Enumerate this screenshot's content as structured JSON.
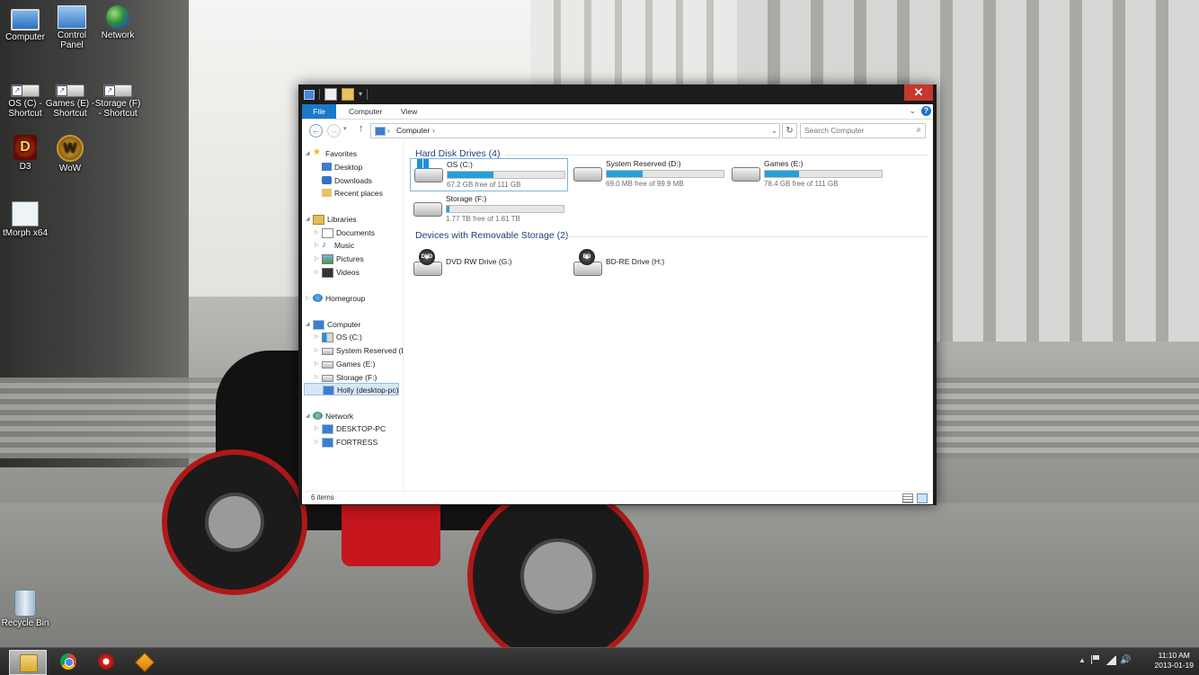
{
  "desktop": {
    "icons": [
      {
        "label": "Computer",
        "icon": "computer-icon"
      },
      {
        "label": "Control Panel",
        "icon": "control-panel-icon"
      },
      {
        "label": "Network",
        "icon": "network-icon"
      },
      {
        "label": "OS (C) - Shortcut",
        "icon": "drive-shortcut-icon"
      },
      {
        "label": "Games (E) - Shortcut",
        "icon": "drive-shortcut-icon"
      },
      {
        "label": "Storage (F) - Shortcut",
        "icon": "drive-shortcut-icon"
      },
      {
        "label": "D3",
        "icon": "diablo3-icon",
        "glyph": "D"
      },
      {
        "label": "WoW",
        "icon": "wow-icon",
        "glyph": "W"
      },
      {
        "label": "tMorph x64",
        "icon": "tmorph-icon"
      },
      {
        "label": "Recycle Bin",
        "icon": "recycle-bin-icon"
      }
    ]
  },
  "window": {
    "close_glyph": "✕",
    "ribbon": {
      "tabs": [
        "File",
        "Computer",
        "View"
      ],
      "help_glyph": "?",
      "minimize_ribbon_glyph": "⌄"
    },
    "address": {
      "path": [
        "Computer"
      ],
      "sep_glyph": "›",
      "search_placeholder": "Search Computer"
    },
    "nav_pane": {
      "favorites": {
        "label": "Favorites",
        "items": [
          "Desktop",
          "Downloads",
          "Recent places"
        ]
      },
      "libraries": {
        "label": "Libraries",
        "items": [
          "Documents",
          "Music",
          "Pictures",
          "Videos"
        ]
      },
      "homegroup": {
        "label": "Homegroup"
      },
      "computer": {
        "label": "Computer",
        "items": [
          "OS (C:)",
          "System Reserved (D:)",
          "Games (E:)",
          "Storage (F:)",
          "Holly (desktop-pc)"
        ]
      },
      "network": {
        "label": "Network",
        "items": [
          "DESKTOP-PC",
          "FORTRESS"
        ]
      }
    },
    "content": {
      "hdd_header": "Hard Disk Drives (4)",
      "drives": [
        {
          "name": "OS (C:)",
          "free": "67.2 GB free of 111 GB",
          "used_fraction": 0.39,
          "icon": "os-drive-icon"
        },
        {
          "name": "System Reserved (D:)",
          "free": "69.0 MB free of 99.9 MB",
          "used_fraction": 0.31,
          "icon": "hard-drive-icon"
        },
        {
          "name": "Games (E:)",
          "free": "78.4 GB free of 111 GB",
          "used_fraction": 0.29,
          "icon": "hard-drive-icon"
        },
        {
          "name": "Storage (F:)",
          "free": "1.77 TB free of 1.81 TB",
          "used_fraction": 0.02,
          "icon": "hard-drive-icon"
        }
      ],
      "removable_header": "Devices with Removable Storage (2)",
      "removable": [
        {
          "name": "DVD RW Drive (G:)",
          "badge": "DVD",
          "icon": "dvd-drive-icon"
        },
        {
          "name": "BD-RE Drive (H:)",
          "badge": "BD",
          "icon": "bd-drive-icon"
        }
      ]
    },
    "status": {
      "items_count": "6 items"
    }
  },
  "taskbar": {
    "apps": [
      "File Explorer",
      "Google Chrome",
      "CCleaner",
      "Winamp"
    ],
    "clock": {
      "time": "11:10 AM",
      "date": "2013-01-19"
    },
    "tray_up_glyph": "▲",
    "volume_glyph": "🔊"
  },
  "colors": {
    "accent": "#1979ca",
    "bar_fill": "#26a0da",
    "close": "#c7372b"
  }
}
